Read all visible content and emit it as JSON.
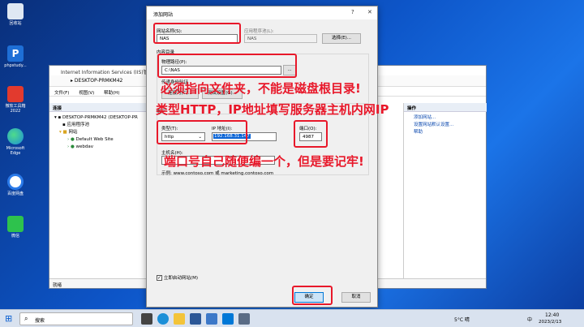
{
  "desktop": {
    "icons": [
      {
        "label": "回收站"
      },
      {
        "label": "phpstudy..."
      },
      {
        "label": "微软工具箱\n2022"
      },
      {
        "label": "Microsoft\nEdge"
      },
      {
        "label": "百度网盘"
      },
      {
        "label": "微信"
      }
    ]
  },
  "iis": {
    "title": "Internet Information Services (IIS)管理器",
    "address": "DESKTOP-PRMKM42",
    "menu": [
      "文件(F)",
      "视图(V)",
      "帮助(H)"
    ],
    "connections_header": "连接",
    "tree": [
      "DESKTOP-PRMKM42 (DESKTOP-PR",
      "应用程序池",
      "网站",
      "Default Web Site",
      "webdav"
    ],
    "actions_header": "操作",
    "actions": [
      "添加网站...",
      "设置网站默认设置...",
      "帮助"
    ],
    "status": "就绪"
  },
  "dialog": {
    "title": "添加网站",
    "help": "?",
    "close": "✕",
    "site_name_label": "网站名称(S):",
    "site_name_value": "NAS",
    "app_pool_label": "应用程序池(L):",
    "app_pool_value": "NAS",
    "select_button": "选择(E)...",
    "content_dir_label": "内容目录",
    "physical_path_label": "物理路径(P):",
    "physical_path_value": "C:\\NAS",
    "browse_button": "...",
    "passthrough_label": "传递身份验证",
    "connect_as_button": "连接为(C)...",
    "test_settings_button": "测试设置(G)...",
    "binding_label": "绑定",
    "type_label": "类型(T):",
    "type_value": "http",
    "ip_label": "IP 地址(I):",
    "ip_value": "192.168.31.147",
    "port_label": "端口(O):",
    "port_value": "4987",
    "hostname_label": "主机名(H):",
    "example_text": "示例: www.contoso.com 或 marketing.contoso.com",
    "start_now_label": "立即启动网站(M)",
    "ok_button": "确定",
    "cancel_button": "取消"
  },
  "annotations": {
    "a1": "必须指向文件夹，不能是磁盘根目录!",
    "a2": "类型HTTP，IP地址填写服务器主机内网IP",
    "a3": "端口号自己随便编一个，但是要记牢!"
  },
  "taskbar": {
    "search_placeholder": "搜索",
    "weather": "5°C 晴",
    "lang": "中",
    "time": "12:40",
    "date": "2023/2/13"
  },
  "colors": {
    "annotation": "#e8182a",
    "desktop": "#0d55c8"
  }
}
